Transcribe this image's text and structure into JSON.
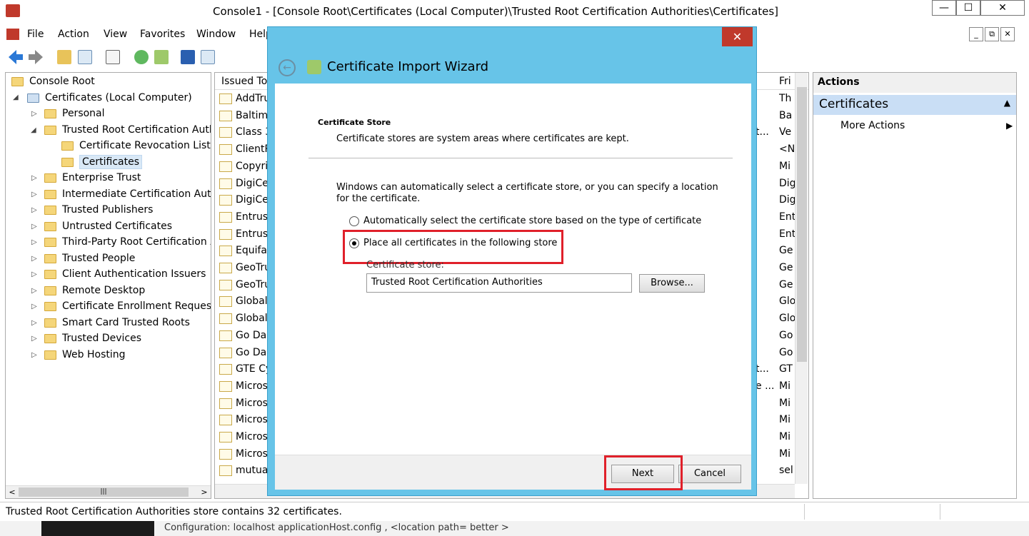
{
  "window": {
    "title": "Console1 - [Console Root\\Certificates (Local Computer)\\Trusted Root Certification Authorities\\Certificates]",
    "minimize": "—",
    "maximize": "☐",
    "close": "✕"
  },
  "menu": [
    "File",
    "Action",
    "View",
    "Favorites",
    "Window",
    "Help"
  ],
  "mdi": [
    "_",
    "⧉",
    "✕"
  ],
  "tree": {
    "root": "Console Root",
    "computer": "Certificates (Local Computer)",
    "items": [
      {
        "label": "Personal"
      },
      {
        "label": "Trusted Root Certification Authorities"
      },
      {
        "label": "Certificate Revocation List"
      },
      {
        "label": "Certificates"
      },
      {
        "label": "Enterprise Trust"
      },
      {
        "label": "Intermediate Certification Authorities"
      },
      {
        "label": "Trusted Publishers"
      },
      {
        "label": "Untrusted Certificates"
      },
      {
        "label": "Third-Party Root Certification Authorities"
      },
      {
        "label": "Trusted People"
      },
      {
        "label": "Client Authentication Issuers"
      },
      {
        "label": "Remote Desktop"
      },
      {
        "label": "Certificate Enrollment Requests"
      },
      {
        "label": "Smart Card Trusted Roots"
      },
      {
        "label": "Trusted Devices"
      },
      {
        "label": "Web Hosting"
      }
    ]
  },
  "list": {
    "col_issued_to": "Issued To",
    "col_friendly": "Fri",
    "rows": [
      {
        "name": "AddTru",
        "frag": "",
        "fri": "Th"
      },
      {
        "name": "Baltim",
        "frag": "",
        "fri": "Ba"
      },
      {
        "name": "Class 3",
        "frag": "t...",
        "fri": "Ve"
      },
      {
        "name": "ClientR",
        "frag": "",
        "fri": "<N"
      },
      {
        "name": "Copyri",
        "frag": "",
        "fri": "Mi"
      },
      {
        "name": "DigiCe",
        "frag": "",
        "fri": "Dig"
      },
      {
        "name": "DigiCe",
        "frag": "",
        "fri": "Dig"
      },
      {
        "name": "Entrust",
        "frag": "",
        "fri": "Ent"
      },
      {
        "name": "Entrust",
        "frag": "",
        "fri": "Ent"
      },
      {
        "name": "Equifax",
        "frag": "",
        "fri": "Ge"
      },
      {
        "name": "GeoTru",
        "frag": "",
        "fri": "Ge"
      },
      {
        "name": "GeoTru",
        "frag": "",
        "fri": "Ge"
      },
      {
        "name": "Global",
        "frag": "",
        "fri": "Glo"
      },
      {
        "name": "Global",
        "frag": "",
        "fri": "Glo"
      },
      {
        "name": "Go Dad",
        "frag": "",
        "fri": "Go"
      },
      {
        "name": "Go Dad",
        "frag": "",
        "fri": "Go"
      },
      {
        "name": "GTE Cy",
        "frag": "t...",
        "fri": "GT"
      },
      {
        "name": "Micros",
        "frag": "e ...",
        "fri": "Mi"
      },
      {
        "name": "Micros",
        "frag": "",
        "fri": "Mi"
      },
      {
        "name": "Micros",
        "frag": "",
        "fri": "Mi"
      },
      {
        "name": "Micros",
        "frag": "",
        "fri": "Mi"
      },
      {
        "name": "Micros",
        "frag": "",
        "fri": "Mi"
      },
      {
        "name": "mutua",
        "frag": "",
        "fri": "sel"
      }
    ]
  },
  "actions": {
    "header": "Actions",
    "section": "Certificates",
    "more": "More Actions"
  },
  "status": "Trusted Root Certification Authorities store contains 32 certificates.",
  "taskbar_text": "Configuration:  localhost  applicationHost.config , <location path= better >",
  "wizard": {
    "title": "Certificate Import Wizard",
    "close": "✕",
    "section_title": "Certificate Store",
    "section_sub": "Certificate stores are system areas where certificates are kept.",
    "description": "Windows can automatically select a certificate store, or you can specify a location for the certificate.",
    "radio_auto": "Automatically select the certificate store based on the type of certificate",
    "radio_place": "Place all certificates in the following store",
    "store_label": "Certificate store:",
    "store_value": "Trusted Root Certification Authorities",
    "browse": "Browse...",
    "next": "Next",
    "cancel": "Cancel"
  }
}
